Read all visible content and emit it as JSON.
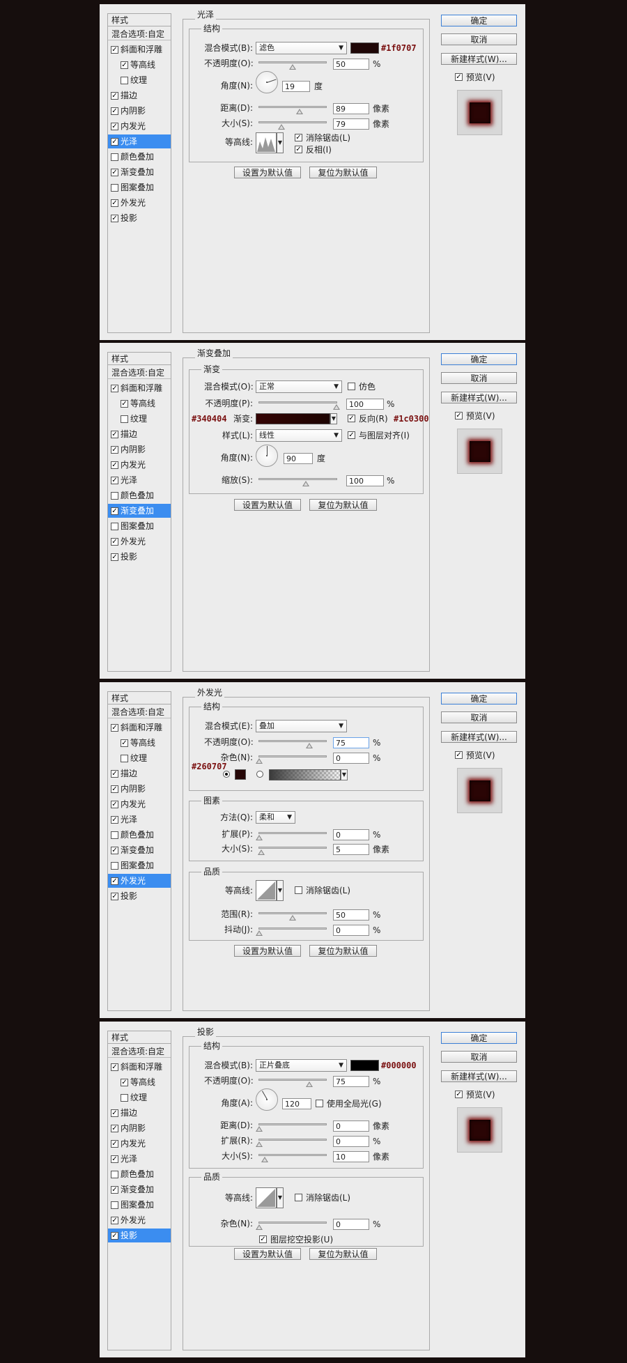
{
  "common": {
    "sidebar_header": "样式",
    "blend_options": "混合选项:自定",
    "sidebar_items": [
      "斜面和浮雕",
      "等高线",
      "纹理",
      "描边",
      "内阴影",
      "内发光",
      "光泽",
      "颜色叠加",
      "渐变叠加",
      "图案叠加",
      "外发光",
      "投影"
    ],
    "ok": "确定",
    "cancel": "取消",
    "new_style": "新建样式(W)...",
    "preview": "预览(V)",
    "set_default": "设置为默认值",
    "reset_default": "复位为默认值",
    "structure": "结构",
    "quality": "品质",
    "unit_percent": "%",
    "unit_px": "像素",
    "unit_degree": "度"
  },
  "satin": {
    "title": "光泽",
    "blend_label": "混合模式(B):",
    "blend_value": "滤色",
    "color_hex": "#1f0707",
    "color": "#1f0707",
    "opacity_label": "不透明度(O):",
    "opacity": "50",
    "angle_label": "角度(N):",
    "angle": "19",
    "distance_label": "距离(D):",
    "distance": "89",
    "size_label": "大小(S):",
    "size": "79",
    "contour_label": "等高线:",
    "antialias": "消除锯齿(L)",
    "invert": "反相(I)"
  },
  "gradient": {
    "title": "渐变叠加",
    "sub_title": "渐变",
    "blend_label": "混合模式(O):",
    "blend_value": "正常",
    "dither": "仿色",
    "opacity_label": "不透明度(P):",
    "opacity": "100",
    "gradient_label": "渐变:",
    "left_hex": "#340404",
    "right_hex": "#1c0300",
    "color_start": "#340404",
    "color_end": "#1c0300",
    "reverse": "反向(R)",
    "style_label": "样式(L):",
    "style_value": "线性",
    "align": "与图层对齐(I)",
    "angle_label": "角度(N):",
    "angle": "90",
    "scale_label": "缩放(S):",
    "scale": "100"
  },
  "outer_glow": {
    "title": "外发光",
    "blend_label": "混合模式(E):",
    "blend_value": "叠加",
    "opacity_label": "不透明度(O):",
    "opacity": "75",
    "noise_label": "杂色(N):",
    "noise": "0",
    "color_hex": "#260707",
    "color": "#260707",
    "elements_title": "图素",
    "technique_label": "方法(Q):",
    "technique_value": "柔和",
    "spread_label": "扩展(P):",
    "spread": "0",
    "size_label": "大小(S):",
    "size": "5",
    "contour_label": "等高线:",
    "antialias": "消除锯齿(L)",
    "range_label": "范围(R):",
    "range": "50",
    "jitter_label": "抖动(J):",
    "jitter": "0"
  },
  "drop_shadow": {
    "title": "投影",
    "blend_label": "混合模式(B):",
    "blend_value": "正片叠底",
    "color_hex": "#000000",
    "color": "#000000",
    "opacity_label": "不透明度(O):",
    "opacity": "75",
    "angle_label": "角度(A):",
    "angle": "120",
    "global_light": "使用全局光(G)",
    "distance_label": "距离(D):",
    "distance": "0",
    "spread_label": "扩展(R):",
    "spread": "0",
    "size_label": "大小(S):",
    "size": "10",
    "contour_label": "等高线:",
    "antialias": "消除锯齿(L)",
    "noise_label": "杂色(N):",
    "noise": "0",
    "knockout": "图层挖空投影(U)"
  }
}
